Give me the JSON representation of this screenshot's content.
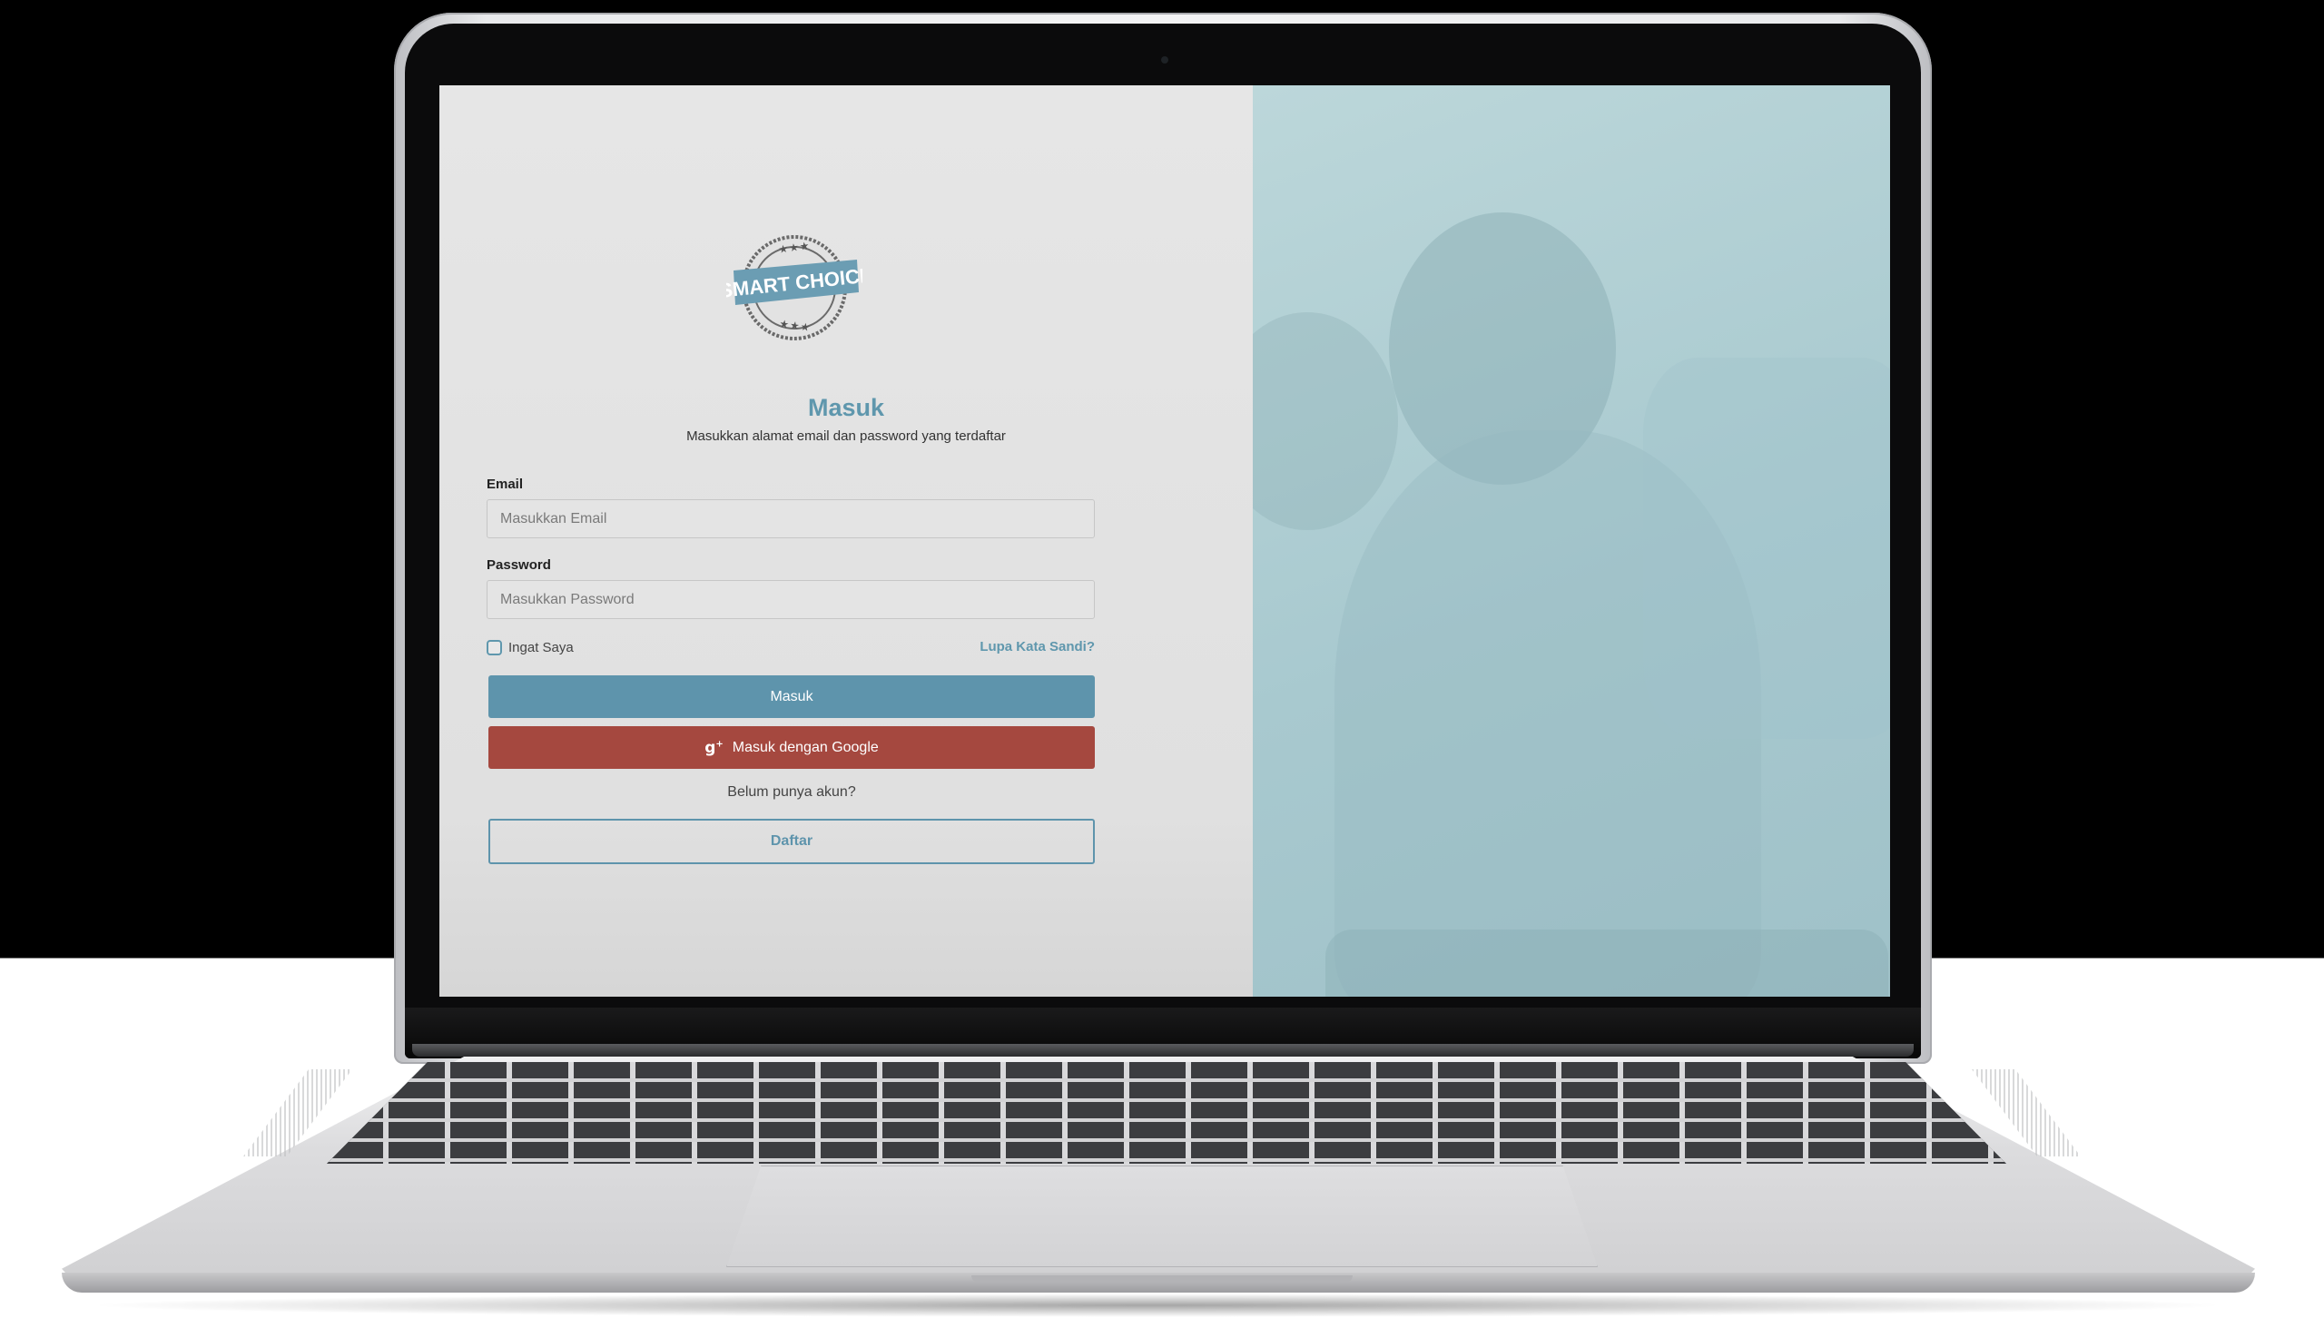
{
  "login": {
    "logo_alt": "SMART CHOICE",
    "logo_text": "SMART CHOICE",
    "title": "Masuk",
    "subtitle": "Masukkan alamat email dan password yang terdaftar",
    "email_label": "Email",
    "email_placeholder": "Masukkan Email",
    "password_label": "Password",
    "password_placeholder": "Masukkan Password",
    "remember_label": "Ingat Saya",
    "forgot_link": "Lupa Kata Sandi?",
    "login_button": "Masuk",
    "google_button": "Masuk dengan Google",
    "google_icon": "google-plus-icon",
    "no_account_text": "Belum punya akun?",
    "register_button": "Daftar"
  },
  "colors": {
    "accent": "#5e94ac",
    "google": "#a5483f",
    "right_panel": "#a8c9cf"
  }
}
